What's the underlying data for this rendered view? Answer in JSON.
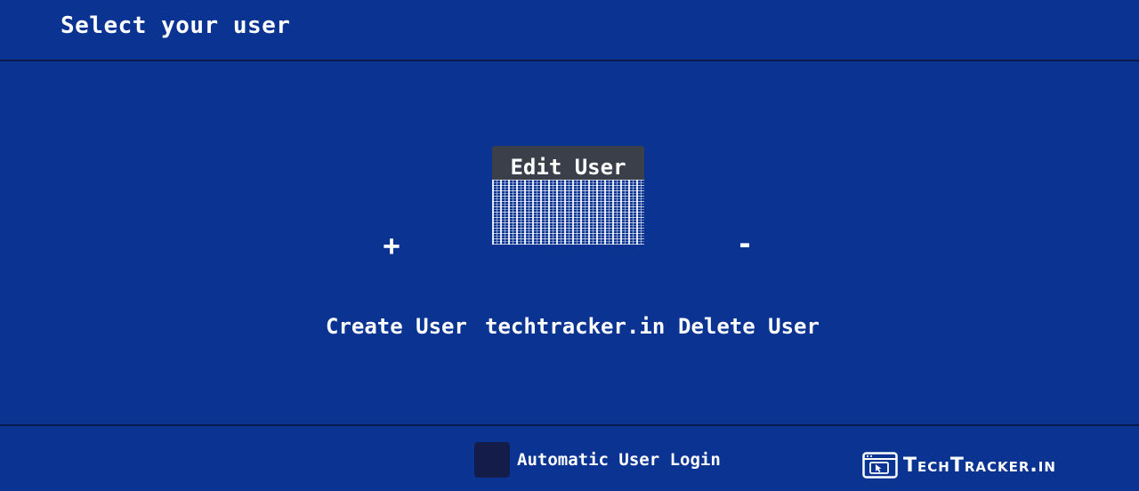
{
  "header": {
    "title": "Select your user"
  },
  "users": {
    "create": {
      "symbol": "+",
      "label": "Create User"
    },
    "current": {
      "tooltip": "Edit User",
      "label": "techtracker.in"
    },
    "delete": {
      "symbol": "-",
      "label": "Delete User"
    }
  },
  "footer": {
    "auto_login_label": "Automatic User Login",
    "auto_login_checked": false
  },
  "watermark": {
    "text": "TechTracker.in",
    "icon": "browser-cursor-icon"
  },
  "colors": {
    "background": "#0a3392",
    "divider": "#0a1a4d",
    "tooltip": "#3a3f4a",
    "checkbox": "#141d4a",
    "text": "#ffffff"
  }
}
